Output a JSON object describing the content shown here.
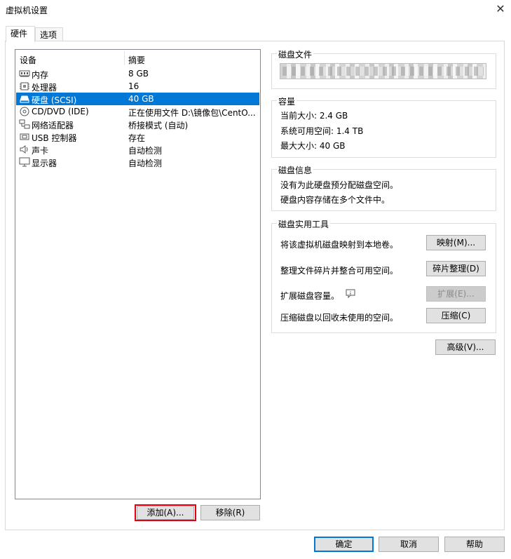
{
  "window": {
    "title": "虚拟机设置",
    "close": "✕"
  },
  "tabs": [
    {
      "label": "硬件"
    },
    {
      "label": "选项"
    }
  ],
  "devices": {
    "header_device": "设备",
    "header_summary": "摘要",
    "items": [
      {
        "name": "内存",
        "summary": "8 GB",
        "icon": "memory-icon"
      },
      {
        "name": "处理器",
        "summary": "16",
        "icon": "processor-icon"
      },
      {
        "name": "硬盘 (SCSI)",
        "summary": "40 GB",
        "icon": "harddisk-icon"
      },
      {
        "name": "CD/DVD (IDE)",
        "summary": "正在使用文件 D:\\镜像包\\CentO...",
        "icon": "cd-dvd-icon"
      },
      {
        "name": "网络适配器",
        "summary": "桥接模式 (自动)",
        "icon": "network-adapter-icon"
      },
      {
        "name": "USB 控制器",
        "summary": "存在",
        "icon": "usb-icon"
      },
      {
        "name": "声卡",
        "summary": "自动检测",
        "icon": "sound-card-icon"
      },
      {
        "name": "显示器",
        "summary": "自动检测",
        "icon": "display-icon"
      }
    ],
    "add_label": "添加(A)...",
    "remove_label": "移除(R)"
  },
  "disk_file": {
    "label": "磁盘文件"
  },
  "capacity": {
    "label": "容量",
    "current": "当前大小: 2.4 GB",
    "available": "系统可用空间: 1.4 TB",
    "max": "最大大小: 40 GB"
  },
  "disk_info": {
    "label": "磁盘信息",
    "line1": "没有为此硬盘预分配磁盘空间。",
    "line2": "硬盘内容存储在多个文件中。"
  },
  "utilities": {
    "label": "磁盘实用工具",
    "map_text": "将该虚拟机磁盘映射到本地卷。",
    "map_button": "映射(M)...",
    "defrag_text": "整理文件碎片并整合可用空间。",
    "defrag_button": "碎片整理(D)",
    "expand_text": "扩展磁盘容量。",
    "expand_button": "扩展(E)...",
    "compact_text": "压缩磁盘以回收未使用的空间。",
    "compact_button": "压缩(C)"
  },
  "advanced_button": "高级(V)...",
  "footer": {
    "ok": "确定",
    "cancel": "取消",
    "help": "帮助"
  },
  "colors": {
    "selection": "#0078d7",
    "highlight_box": "#e60012"
  }
}
